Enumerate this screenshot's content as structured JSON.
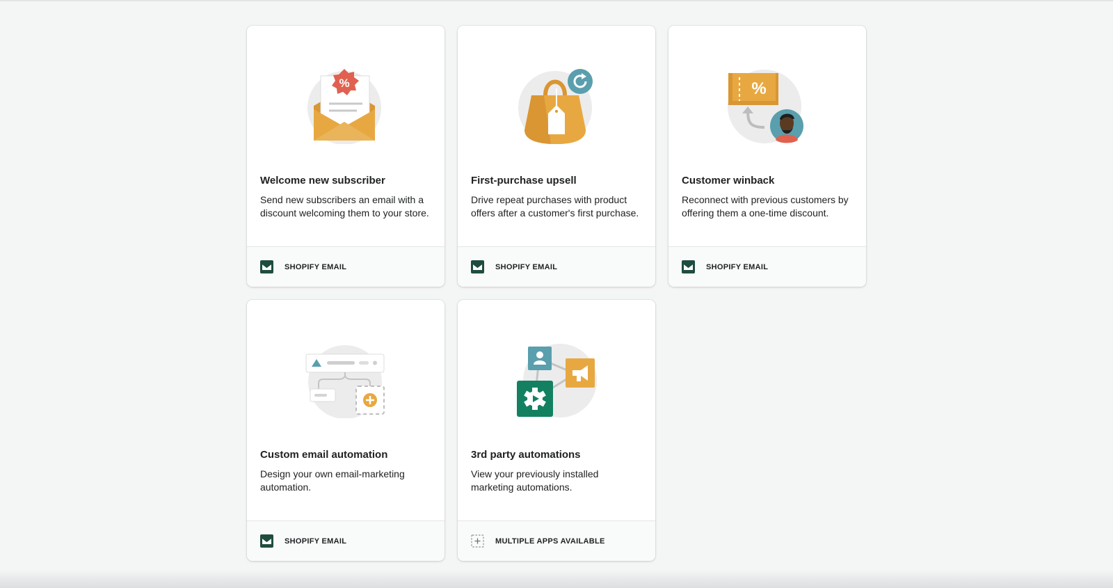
{
  "cards": [
    {
      "title": "Welcome new subscriber",
      "description": "Send new subscribers an email with a discount welcoming them to your store.",
      "footer_label": "SHOPIFY EMAIL",
      "illustration": "envelope-discount-icon",
      "footer_icon": "email-icon"
    },
    {
      "title": "First-purchase upsell",
      "description": "Drive repeat purchases with product offers after a customer's first purchase.",
      "footer_label": "SHOPIFY EMAIL",
      "illustration": "shopping-bag-icon",
      "footer_icon": "email-icon"
    },
    {
      "title": "Customer winback",
      "description": "Reconnect with previous customers by offering them a one-time discount.",
      "footer_label": "SHOPIFY EMAIL",
      "illustration": "coupon-customer-icon",
      "footer_icon": "email-icon"
    },
    {
      "title": "Custom email automation",
      "description": "Design your own email-marketing automation.",
      "footer_label": "SHOPIFY EMAIL",
      "illustration": "workflow-icon",
      "footer_icon": "email-icon"
    },
    {
      "title": "3rd party automations",
      "description": "View your previously installed marketing automations.",
      "footer_label": "MULTIPLE APPS AVAILABLE",
      "illustration": "apps-network-icon",
      "footer_icon": "apps-icon"
    }
  ],
  "colors": {
    "background": "#f4f5f5",
    "accent_orange": "#e8a841",
    "accent_red": "#e0614f",
    "accent_teal": "#5a9fad",
    "accent_green": "#138062",
    "email_icon": "#1e4d3f"
  }
}
